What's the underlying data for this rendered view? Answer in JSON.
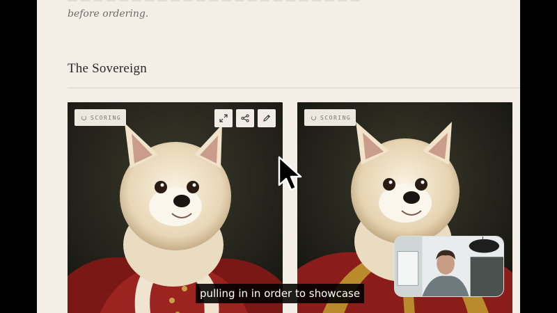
{
  "intro": {
    "line_faded": "— — — — — — — — — — — — — — — — — — — — — — —",
    "line_2": "before ordering."
  },
  "section": {
    "title": "The Sovereign"
  },
  "cards": [
    {
      "badge_label": "SCORING"
    },
    {
      "badge_label": "SCORING"
    }
  ],
  "caption": {
    "text": "pulling in in order to showcase"
  },
  "colors": {
    "page_bg": "#f3efe7",
    "portrait_bg": "#2a2a1f",
    "robe_red": "#8a1d1a",
    "gold_trim": "#b98b2c"
  }
}
